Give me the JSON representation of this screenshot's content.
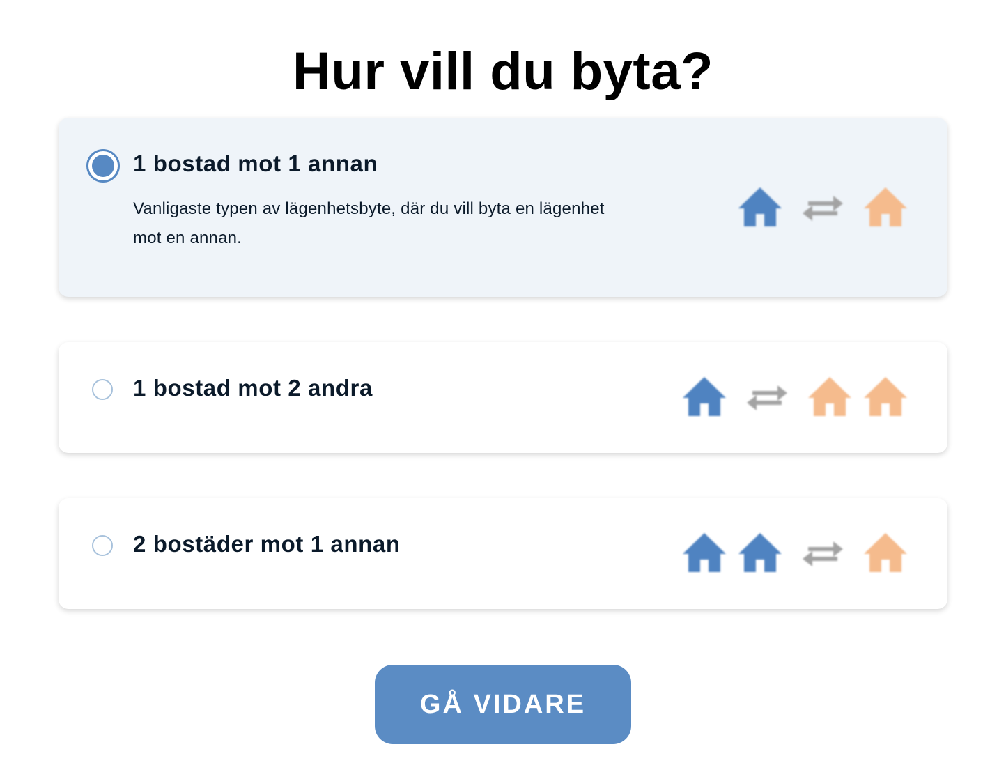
{
  "title": "Hur vill du byta?",
  "options": [
    {
      "title": "1 bostad mot 1 annan",
      "description": "Vanligaste typen av lägenhetsbyte, där du vill byta en lägenhet mot en annan.",
      "selected": true,
      "icons": [
        "house-blue-icon",
        "swap-arrows-icon",
        "house-orange-icon"
      ]
    },
    {
      "title": "1 bostad mot 2 andra",
      "selected": false,
      "icons": [
        "house-blue-icon",
        "swap-arrows-icon",
        "house-orange-icon",
        "house-orange-icon"
      ]
    },
    {
      "title": "2 bostäder mot 1 annan",
      "selected": false,
      "icons": [
        "house-blue-icon",
        "house-blue-icon",
        "swap-arrows-icon",
        "house-orange-icon"
      ]
    }
  ],
  "next_button": {
    "label": "GÅ VIDARE"
  },
  "colors": {
    "accent": "#5b8cc4",
    "house_blue": "#4f83c1",
    "house_orange": "#f5bb8d",
    "swap_gray": "#a3a3a3",
    "selected_bg": "#eff4f9"
  }
}
